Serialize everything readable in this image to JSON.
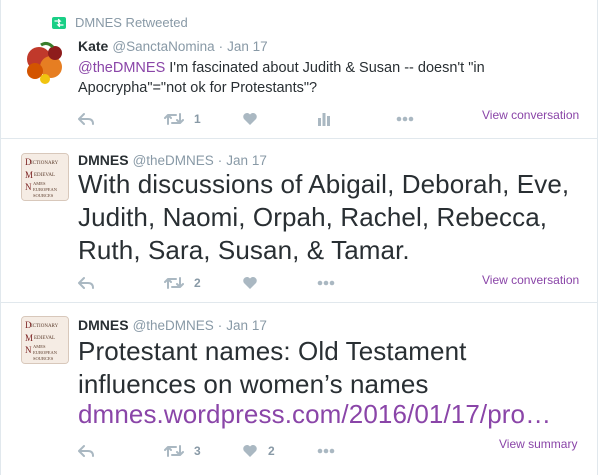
{
  "colors": {
    "accent": "#8a45a8",
    "muted": "#8899a6",
    "retweet_green": "#19cf86"
  },
  "tweets": [
    {
      "context": "DMNES Retweeted",
      "fullname": "Kate",
      "screen_name": "@SanctaNomina",
      "dot": "·",
      "time": "Jan 17",
      "mention": "@theDMNES",
      "text": " I'm fascinated about Judith & Susan -- doesn't \"in Apocrypha\"=\"not ok for Protestants\"?",
      "retweet_count": "1",
      "like_count": "",
      "view_link": "View conversation"
    },
    {
      "fullname": "DMNES",
      "screen_name": "@theDMNES",
      "dot": "·",
      "time": "Jan 17",
      "text": "With discussions of Abigail, Deborah, Eve, Judith, Naomi, Orpah, Rachel, Rebecca, Ruth, Sara, Susan, & Tamar.",
      "retweet_count": "2",
      "view_link": "View conversation"
    },
    {
      "fullname": "DMNES",
      "screen_name": "@theDMNES",
      "dot": "·",
      "time": "Jan 17",
      "text": "Protestant names: Old Testament influences on women’s names",
      "link": "dmnes.wordpress.com/2016/01/17/pro…",
      "retweet_count": "3",
      "like_count": "2",
      "view_link": "View summary"
    }
  ],
  "icons": {
    "reply": "reply-icon",
    "retweet": "retweet-icon",
    "like": "heart-icon",
    "analytics": "analytics-icon",
    "more": "more-icon"
  }
}
